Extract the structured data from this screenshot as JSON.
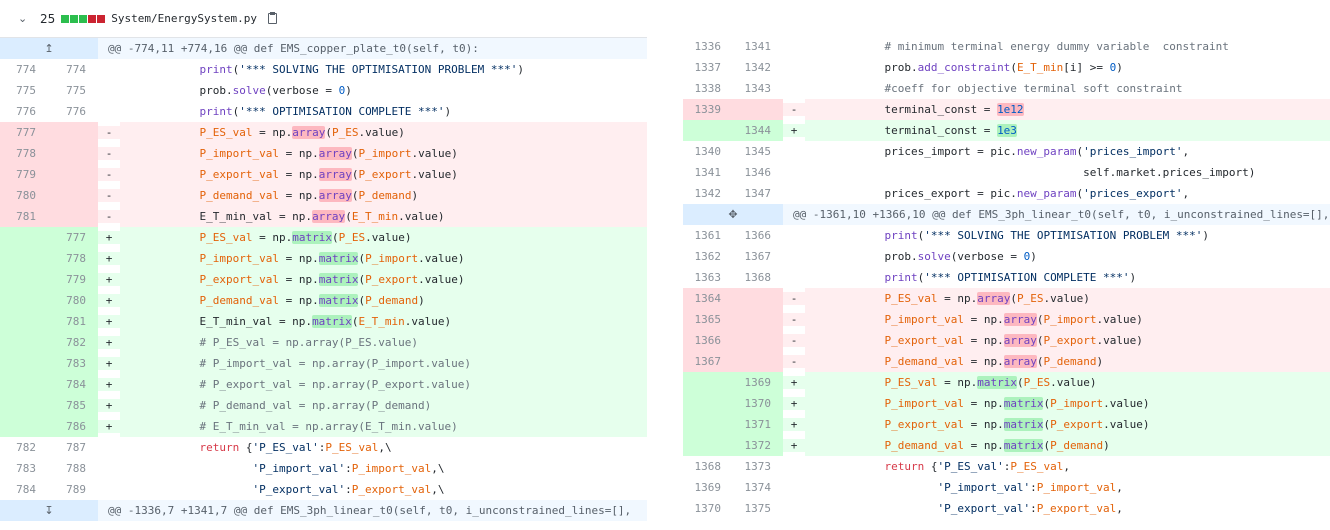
{
  "file": {
    "change_count": "25",
    "blocks": [
      "add",
      "add",
      "add",
      "del",
      "del"
    ],
    "path": "System/EnergySystem.py"
  },
  "left": {
    "hunk_top": "@@ -774,11 +774,16 @@ def EMS_copper_plate_t0(self, t0):",
    "hunk_bottom": "@@ -1336,7 +1341,7 @@ def EMS_3ph_linear_t0(self, t0, i_unconstrained_lines=[],",
    "rows": [
      {
        "t": "ctx",
        "o": "774",
        "n": "774",
        "c": "            print('*** SOLVING THE OPTIMISATION PROBLEM ***')"
      },
      {
        "t": "ctx",
        "o": "775",
        "n": "775",
        "c": "            prob.solve(verbose = 0)"
      },
      {
        "t": "ctx",
        "o": "776",
        "n": "776",
        "c": "            print('*** OPTIMISATION COMPLETE ***')"
      },
      {
        "t": "del",
        "o": "777",
        "n": "",
        "c": "            P_ES_val = np.array(P_ES.value)"
      },
      {
        "t": "del",
        "o": "778",
        "n": "",
        "c": "            P_import_val = np.array(P_import.value)"
      },
      {
        "t": "del",
        "o": "779",
        "n": "",
        "c": "            P_export_val = np.array(P_export.value)"
      },
      {
        "t": "del",
        "o": "780",
        "n": "",
        "c": "            P_demand_val = np.array(P_demand)"
      },
      {
        "t": "del",
        "o": "781",
        "n": "",
        "c": "            E_T_min_val = np.array(E_T_min.value)"
      },
      {
        "t": "add",
        "o": "",
        "n": "777",
        "c": "            P_ES_val = np.matrix(P_ES.value)"
      },
      {
        "t": "add",
        "o": "",
        "n": "778",
        "c": "            P_import_val = np.matrix(P_import.value)"
      },
      {
        "t": "add",
        "o": "",
        "n": "779",
        "c": "            P_export_val = np.matrix(P_export.value)"
      },
      {
        "t": "add",
        "o": "",
        "n": "780",
        "c": "            P_demand_val = np.matrix(P_demand)"
      },
      {
        "t": "add",
        "o": "",
        "n": "781",
        "c": "            E_T_min_val = np.matrix(E_T_min.value)"
      },
      {
        "t": "add",
        "o": "",
        "n": "782",
        "c": "            # P_ES_val = np.array(P_ES.value)"
      },
      {
        "t": "add",
        "o": "",
        "n": "783",
        "c": "            # P_import_val = np.array(P_import.value)"
      },
      {
        "t": "add",
        "o": "",
        "n": "784",
        "c": "            # P_export_val = np.array(P_export.value)"
      },
      {
        "t": "add",
        "o": "",
        "n": "785",
        "c": "            # P_demand_val = np.array(P_demand)"
      },
      {
        "t": "add",
        "o": "",
        "n": "786",
        "c": "            # E_T_min_val = np.array(E_T_min.value)"
      },
      {
        "t": "ctx",
        "o": "782",
        "n": "787",
        "c": "            return {'P_ES_val':P_ES_val,\\"
      },
      {
        "t": "ctx",
        "o": "783",
        "n": "788",
        "c": "                    'P_import_val':P_import_val,\\"
      },
      {
        "t": "ctx",
        "o": "784",
        "n": "789",
        "c": "                    'P_export_val':P_export_val,\\"
      }
    ]
  },
  "right": {
    "hunk": "@@ -1361,10 +1366,10 @@ def EMS_3ph_linear_t0(self, t0, i_unconstrained_lines=[],",
    "rows_top": [
      {
        "t": "ctx",
        "o": "1336",
        "n": "1341",
        "c": "            # minimum terminal energy dummy variable  constraint"
      },
      {
        "t": "ctx",
        "o": "1337",
        "n": "1342",
        "c": "            prob.add_constraint(E_T_min[i] >= 0)"
      },
      {
        "t": "ctx",
        "o": "1338",
        "n": "1343",
        "c": "            #coeff for objective terminal soft constraint"
      },
      {
        "t": "del",
        "o": "1339",
        "n": "",
        "c": "            terminal_const = 1e12"
      },
      {
        "t": "add",
        "o": "",
        "n": "1344",
        "c": "            terminal_const = 1e3"
      },
      {
        "t": "ctx",
        "o": "1340",
        "n": "1345",
        "c": "            prices_import = pic.new_param('prices_import',"
      },
      {
        "t": "ctx",
        "o": "1341",
        "n": "1346",
        "c": "                                          self.market.prices_import)"
      },
      {
        "t": "ctx",
        "o": "1342",
        "n": "1347",
        "c": "            prices_export = pic.new_param('prices_export',"
      }
    ],
    "rows_bottom": [
      {
        "t": "ctx",
        "o": "1361",
        "n": "1366",
        "c": "            print('*** SOLVING THE OPTIMISATION PROBLEM ***')"
      },
      {
        "t": "ctx",
        "o": "1362",
        "n": "1367",
        "c": "            prob.solve(verbose = 0)"
      },
      {
        "t": "ctx",
        "o": "1363",
        "n": "1368",
        "c": "            print('*** OPTIMISATION COMPLETE ***')"
      },
      {
        "t": "del",
        "o": "1364",
        "n": "",
        "c": "            P_ES_val = np.array(P_ES.value)"
      },
      {
        "t": "del",
        "o": "1365",
        "n": "",
        "c": "            P_import_val = np.array(P_import.value)"
      },
      {
        "t": "del",
        "o": "1366",
        "n": "",
        "c": "            P_export_val = np.array(P_export.value)"
      },
      {
        "t": "del",
        "o": "1367",
        "n": "",
        "c": "            P_demand_val = np.array(P_demand)"
      },
      {
        "t": "add",
        "o": "",
        "n": "1369",
        "c": "            P_ES_val = np.matrix(P_ES.value)"
      },
      {
        "t": "add",
        "o": "",
        "n": "1370",
        "c": "            P_import_val = np.matrix(P_import.value)"
      },
      {
        "t": "add",
        "o": "",
        "n": "1371",
        "c": "            P_export_val = np.matrix(P_export.value)"
      },
      {
        "t": "add",
        "o": "",
        "n": "1372",
        "c": "            P_demand_val = np.matrix(P_demand)"
      },
      {
        "t": "ctx",
        "o": "1368",
        "n": "1373",
        "c": "            return {'P_ES_val':P_ES_val,"
      },
      {
        "t": "ctx",
        "o": "1369",
        "n": "1374",
        "c": "                    'P_import_val':P_import_val,"
      },
      {
        "t": "ctx",
        "o": "1370",
        "n": "1375",
        "c": "                    'P_export_val':P_export_val,"
      }
    ]
  },
  "colors": {
    "add_bg": "#e6ffed",
    "del_bg": "#ffeef0",
    "hunk_bg": "#f1f8ff"
  },
  "icons": {
    "collapse": "chevron-down-icon",
    "copy": "copy-icon",
    "expand_up": "expand-up-icon",
    "expand_down": "expand-down-icon",
    "expand_both": "expand-both-icon"
  }
}
